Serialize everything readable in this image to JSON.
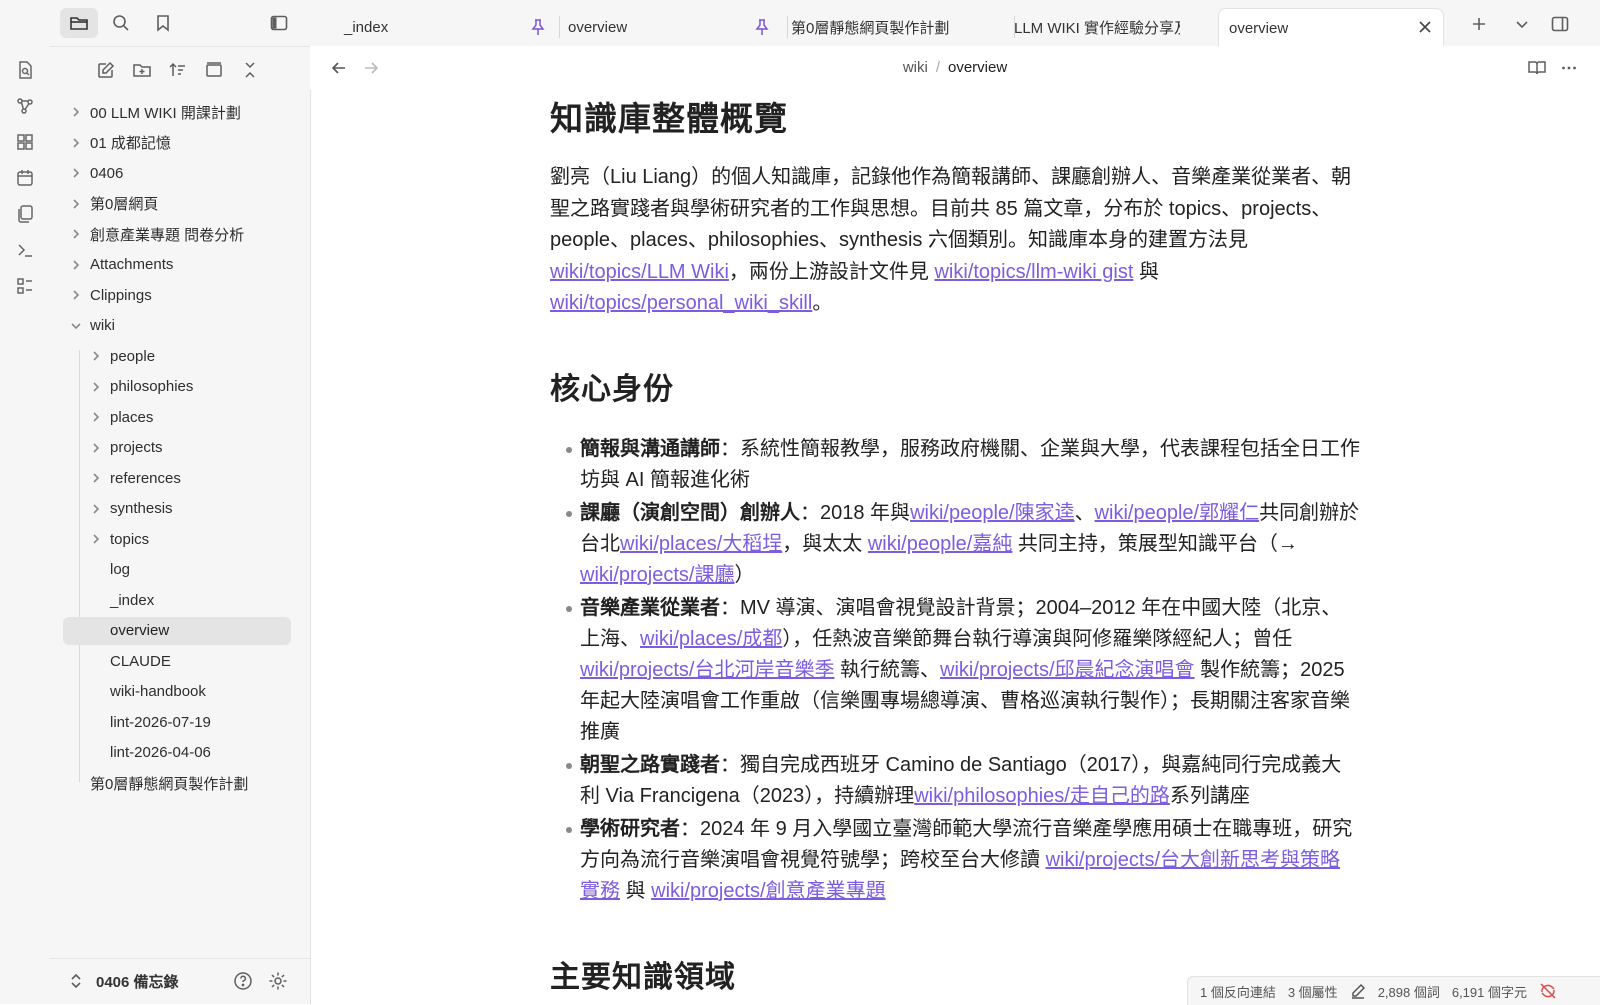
{
  "app": {
    "accent_color": "#7c5ce0"
  },
  "ribbon": {
    "icons": [
      "switcher-icon",
      "graph-icon",
      "canvas-icon",
      "calendar-icon",
      "templates-icon",
      "terminal-icon",
      "command-palette-icon"
    ]
  },
  "sidebar": {
    "top_icons": [
      "folder-icon",
      "search-icon",
      "bookmark-icon",
      "collapse-sidebar-icon"
    ],
    "action_icons": [
      "new-note-icon",
      "new-folder-icon",
      "sort-icon",
      "auto-reveal-icon",
      "collapse-all-icon"
    ],
    "tree": [
      {
        "label": "00 LLM WIKI 開課計劃",
        "folder": true,
        "open": false,
        "depth": 0
      },
      {
        "label": "01 成都記憶",
        "folder": true,
        "open": false,
        "depth": 0
      },
      {
        "label": "0406",
        "folder": true,
        "open": false,
        "depth": 0
      },
      {
        "label": "第0層網頁",
        "folder": true,
        "open": false,
        "depth": 0
      },
      {
        "label": "創意產業專題 問卷分析",
        "folder": true,
        "open": false,
        "depth": 0
      },
      {
        "label": "Attachments",
        "folder": true,
        "open": false,
        "depth": 0
      },
      {
        "label": "Clippings",
        "folder": true,
        "open": false,
        "depth": 0
      },
      {
        "label": "wiki",
        "folder": true,
        "open": true,
        "depth": 0
      },
      {
        "label": "people",
        "folder": true,
        "open": false,
        "depth": 1
      },
      {
        "label": "philosophies",
        "folder": true,
        "open": false,
        "depth": 1
      },
      {
        "label": "places",
        "folder": true,
        "open": false,
        "depth": 1
      },
      {
        "label": "projects",
        "folder": true,
        "open": false,
        "depth": 1
      },
      {
        "label": "references",
        "folder": true,
        "open": false,
        "depth": 1
      },
      {
        "label": "synthesis",
        "folder": true,
        "open": false,
        "depth": 1
      },
      {
        "label": "topics",
        "folder": true,
        "open": false,
        "depth": 1
      },
      {
        "label": "log",
        "folder": false,
        "depth": 1
      },
      {
        "label": "_index",
        "folder": false,
        "depth": 1
      },
      {
        "label": "overview",
        "folder": false,
        "depth": 1,
        "active": true
      },
      {
        "label": "CLAUDE",
        "folder": false,
        "depth": 1
      },
      {
        "label": "wiki-handbook",
        "folder": false,
        "depth": 1
      },
      {
        "label": "lint-2026-07-19",
        "folder": false,
        "depth": 1
      },
      {
        "label": "lint-2026-04-06",
        "folder": false,
        "depth": 1
      },
      {
        "label": "第0層靜態網頁製作計劃",
        "folder": false,
        "depth": 0
      }
    ],
    "vault_name": "0406 備忘錄"
  },
  "tabs": [
    {
      "label": "_index",
      "pinned": true
    },
    {
      "label": "overview",
      "pinned": true
    },
    {
      "label": "第0層靜態網頁製作計劃",
      "pinned": false
    },
    {
      "label": "LLM WIKI 實作經驗分享及工...",
      "pinned": false
    },
    {
      "label": "overview",
      "pinned": false,
      "active": true
    }
  ],
  "breadcrumb": {
    "parent": "wiki",
    "current": "overview"
  },
  "doc": {
    "h1_overview": "知識庫整體概覽",
    "intro": [
      {
        "t": "劉亮（Liu Liang）的個人知識庫，記錄他作為簡報講師、課廳創辦人、音樂產業從業者、朝聖之路實踐者與學術研究者的工作與思想。目前共 85 篇文章，分布於 topics、projects、people、places、philosophies、synthesis 六個類別。知識庫本身的建置方法見 "
      },
      {
        "link": "wiki/topics/LLM Wiki"
      },
      {
        "t": "，兩份上游設計文件見 "
      },
      {
        "link": "wiki/topics/llm-wiki gist"
      },
      {
        "t": " 與 "
      },
      {
        "link": "wiki/topics/personal_wiki_skill"
      },
      {
        "t": "。"
      }
    ],
    "h2_identity": "核心身份",
    "identity": [
      [
        {
          "b": "簡報與溝通講師"
        },
        {
          "t": "：系統性簡報教學，服務政府機關、企業與大學，代表課程包括全日工作坊與 AI 簡報進化術"
        }
      ],
      [
        {
          "b": "課廳（演創空間）創辦人"
        },
        {
          "t": "：2018 年與"
        },
        {
          "link": "wiki/people/陳家逵"
        },
        {
          "t": "、"
        },
        {
          "link": "wiki/people/郭耀仁"
        },
        {
          "t": "共同創辦於台北"
        },
        {
          "link": "wiki/places/大稻埕"
        },
        {
          "t": "，與太太 "
        },
        {
          "link": "wiki/people/嘉純"
        },
        {
          "t": " 共同主持，策展型知識平台（→ "
        },
        {
          "link": "wiki/projects/課廳"
        },
        {
          "t": "）"
        }
      ],
      [
        {
          "b": "音樂產業從業者"
        },
        {
          "t": "：MV 導演、演唱會視覺設計背景；2004–2012 年在中國大陸（北京、上海、"
        },
        {
          "link": "wiki/places/成都"
        },
        {
          "t": "），任熱波音樂節舞台執行導演與阿修羅樂隊經紀人；曾任 "
        },
        {
          "link": "wiki/projects/台北河岸音樂季"
        },
        {
          "t": " 執行統籌、"
        },
        {
          "link": "wiki/projects/邱晨紀念演唱會"
        },
        {
          "t": " 製作統籌；2025 年起大陸演唱會工作重啟（信樂團專場總導演、曹格巡演執行製作）；長期關注客家音樂推廣"
        }
      ],
      [
        {
          "b": "朝聖之路實踐者"
        },
        {
          "t": "：獨自完成西班牙 Camino de Santiago（2017），與嘉純同行完成義大利 Via Francigena（2023），持續辦理"
        },
        {
          "link": "wiki/philosophies/走自己的路"
        },
        {
          "t": "系列講座"
        }
      ],
      [
        {
          "b": "學術研究者"
        },
        {
          "t": "：2024 年 9 月入學國立臺灣師範大學流行音樂產學應用碩士在職專班，研究方向為流行音樂演唱會視覺符號學；跨校至台大修讀 "
        },
        {
          "link": "wiki/projects/台大創新思考與策略實務"
        },
        {
          "t": " 與 "
        },
        {
          "link": "wiki/projects/創意產業專題"
        }
      ]
    ],
    "h2_domains": "主要知識領域"
  },
  "status": {
    "backlinks": "1 個反向連結",
    "properties": "3 個屬性",
    "words": "2,898 個詞",
    "chars": "6,191 個字元"
  }
}
